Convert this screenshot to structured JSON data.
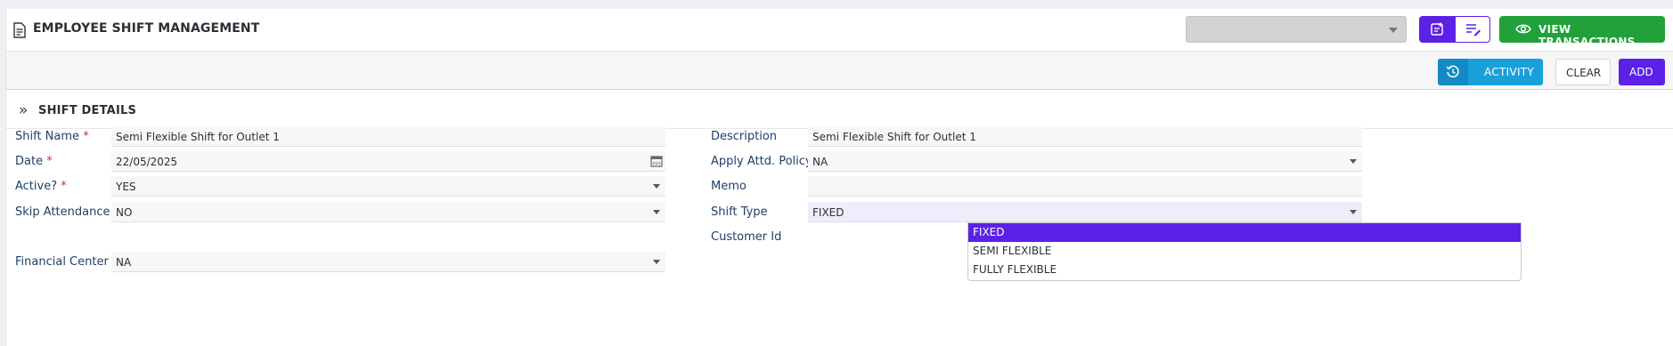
{
  "header": {
    "title": "EMPLOYEE SHIFT MANAGEMENT",
    "title_icon": "document-icon",
    "top_select_value": "",
    "view_transactions_label": "VIEW TRANSACTIONS"
  },
  "toolbar": {
    "activity_label": "ACTIVITY",
    "clear_label": "CLEAR",
    "add_label": "ADD"
  },
  "section": {
    "title": "SHIFT DETAILS"
  },
  "form": {
    "shift_name": {
      "label": "Shift Name",
      "required": "*",
      "value": "Semi Flexible Shift for Outlet 1"
    },
    "date": {
      "label": "Date",
      "required": "*",
      "value": "22/05/2025"
    },
    "active": {
      "label": "Active?",
      "required": "*",
      "value": "YES"
    },
    "skip_attendance": {
      "label": "Skip Attendance",
      "value": "NO"
    },
    "financial_center": {
      "label": "Financial Center",
      "value": "NA"
    },
    "description": {
      "label": "Description",
      "value": "Semi Flexible Shift for Outlet 1"
    },
    "apply_attd_policy": {
      "label": "Apply Attd. Policy",
      "required": "*",
      "value": "NA"
    },
    "memo": {
      "label": "Memo",
      "value": ""
    },
    "shift_type": {
      "label": "Shift Type",
      "value": "FIXED",
      "options": [
        "FIXED",
        "SEMI FLEXIBLE",
        "FULLY FLEXIBLE"
      ],
      "selected_index": 0
    },
    "customer_id": {
      "label": "Customer Id",
      "value": ""
    }
  },
  "colors": {
    "primary": "#5b21e6",
    "success": "#22a13a",
    "info": "#18a0db",
    "required": "#d0312d",
    "label": "#1f3f66"
  }
}
